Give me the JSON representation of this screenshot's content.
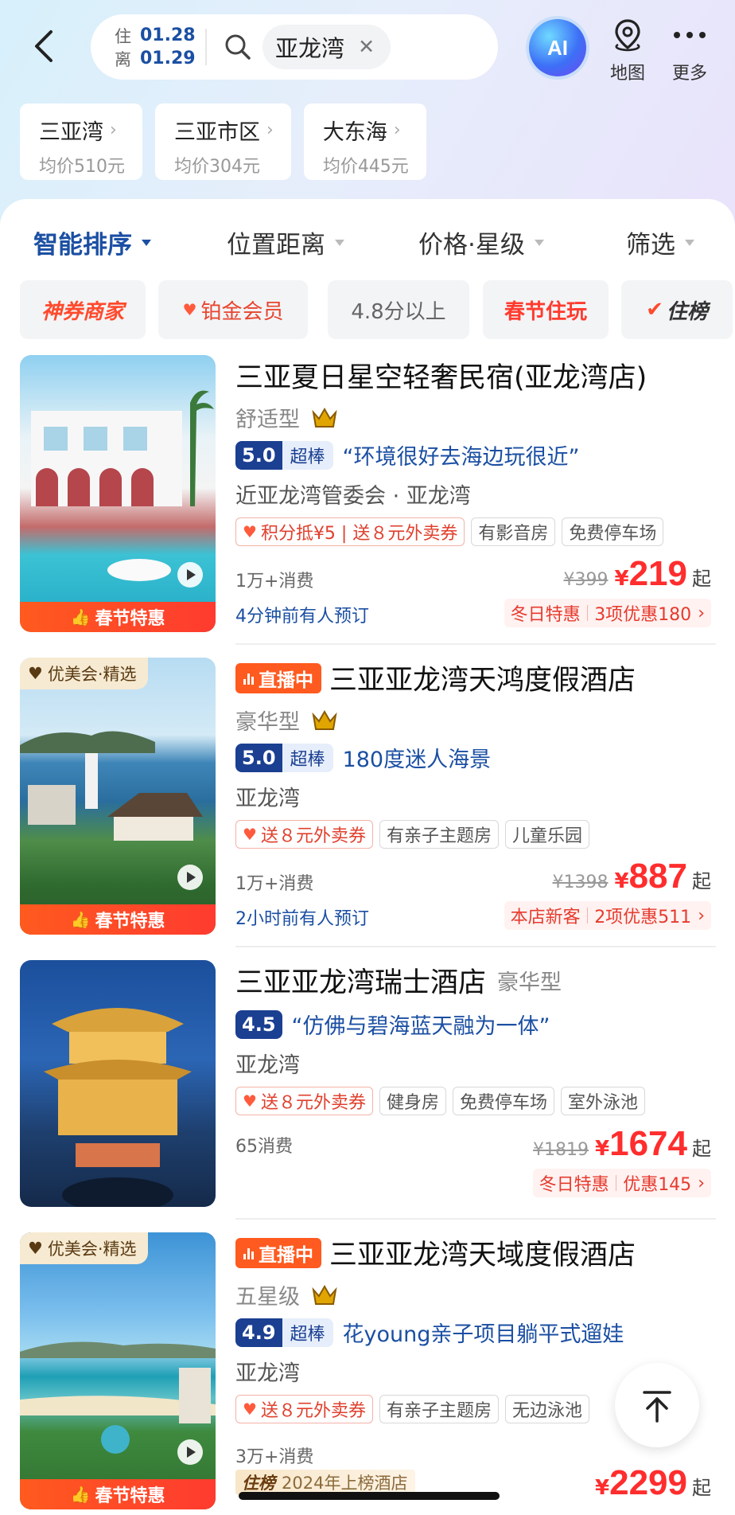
{
  "header": {
    "checkin_label": "住",
    "checkin_date": "01.28",
    "checkout_label": "离",
    "checkout_date": "01.29",
    "search_value": "亚龙湾",
    "ai_label": "AI",
    "map_label": "地图",
    "more_label": "更多"
  },
  "areas": [
    {
      "name": "三亚湾",
      "avg": "均价510元"
    },
    {
      "name": "三亚市区",
      "avg": "均价304元"
    },
    {
      "name": "大东海",
      "avg": "均价445元"
    }
  ],
  "sort": {
    "smart": "智能排序",
    "distance": "位置距离",
    "price_star": "价格·星级",
    "filter": "筛选"
  },
  "quick_tags": [
    "神券商家",
    "铂金会员",
    "4.8分以上",
    "春节住玩",
    "住榜"
  ],
  "hotels": [
    {
      "name": "三亚夏日星空轻奢民宿(亚龙湾店)",
      "type": "舒适型",
      "score": "5.0",
      "score_word": "超棒",
      "quote": "“环境很好去海边玩很近”",
      "location": "近亚龙湾管委会 · 亚龙湾",
      "promo": "积分抵¥5 | 送８元外卖券",
      "tags": [
        "有影音房",
        "免费停车场"
      ],
      "consume": "1万+消费",
      "booked": "4分钟前有人预订",
      "orig_price": "¥399",
      "price": "219",
      "deal_a": "冬日特惠",
      "deal_b": "3项优惠180",
      "badge": "春节特惠"
    },
    {
      "select": "优美会·精选",
      "live": "直播中",
      "name": "三亚亚龙湾天鸿度假酒店",
      "type": "豪华型",
      "score": "5.0",
      "score_word": "超棒",
      "quote": "180度迷人海景",
      "location": "亚龙湾",
      "promo": "送８元外卖券",
      "tags": [
        "有亲子主题房",
        "儿童乐园"
      ],
      "consume": "1万+消费",
      "booked": "2小时前有人预订",
      "orig_price": "¥1398",
      "price": "887",
      "deal_a": "本店新客",
      "deal_b": "2项优惠511",
      "badge": "春节特惠"
    },
    {
      "name": "三亚亚龙湾瑞士酒店",
      "type": "豪华型",
      "score": "4.5",
      "quote": "“仿佛与碧海蓝天融为一体”",
      "location": "亚龙湾",
      "promo": "送８元外卖券",
      "tags": [
        "健身房",
        "免费停车场",
        "室外泳池"
      ],
      "consume": "65消费",
      "orig_price": "¥1819",
      "price": "1674",
      "deal_a": "冬日特惠",
      "deal_b": "优惠145"
    },
    {
      "select": "优美会·精选",
      "live": "直播中",
      "name": "三亚亚龙湾天域度假酒店",
      "type": "五星级",
      "score": "4.9",
      "score_word": "超棒",
      "quote": "花young亲子项目躺平式遛娃",
      "location": "亚龙湾",
      "promo": "送８元外卖券",
      "tags": [
        "有亲子主题房",
        "无边泳池"
      ],
      "consume": "3万+消费",
      "rank_icon": "住榜",
      "rank": "2024年上榜酒店",
      "price": "2299",
      "badge": "春节特惠"
    }
  ],
  "common": {
    "yen": "¥",
    "qi": "起",
    "deal_chev": "›",
    "area_chev": "›"
  },
  "colors": {
    "brand_blue": "#1b4fa3",
    "price_red": "#ff2d2d",
    "badge_orange": "#ff5a1f"
  }
}
